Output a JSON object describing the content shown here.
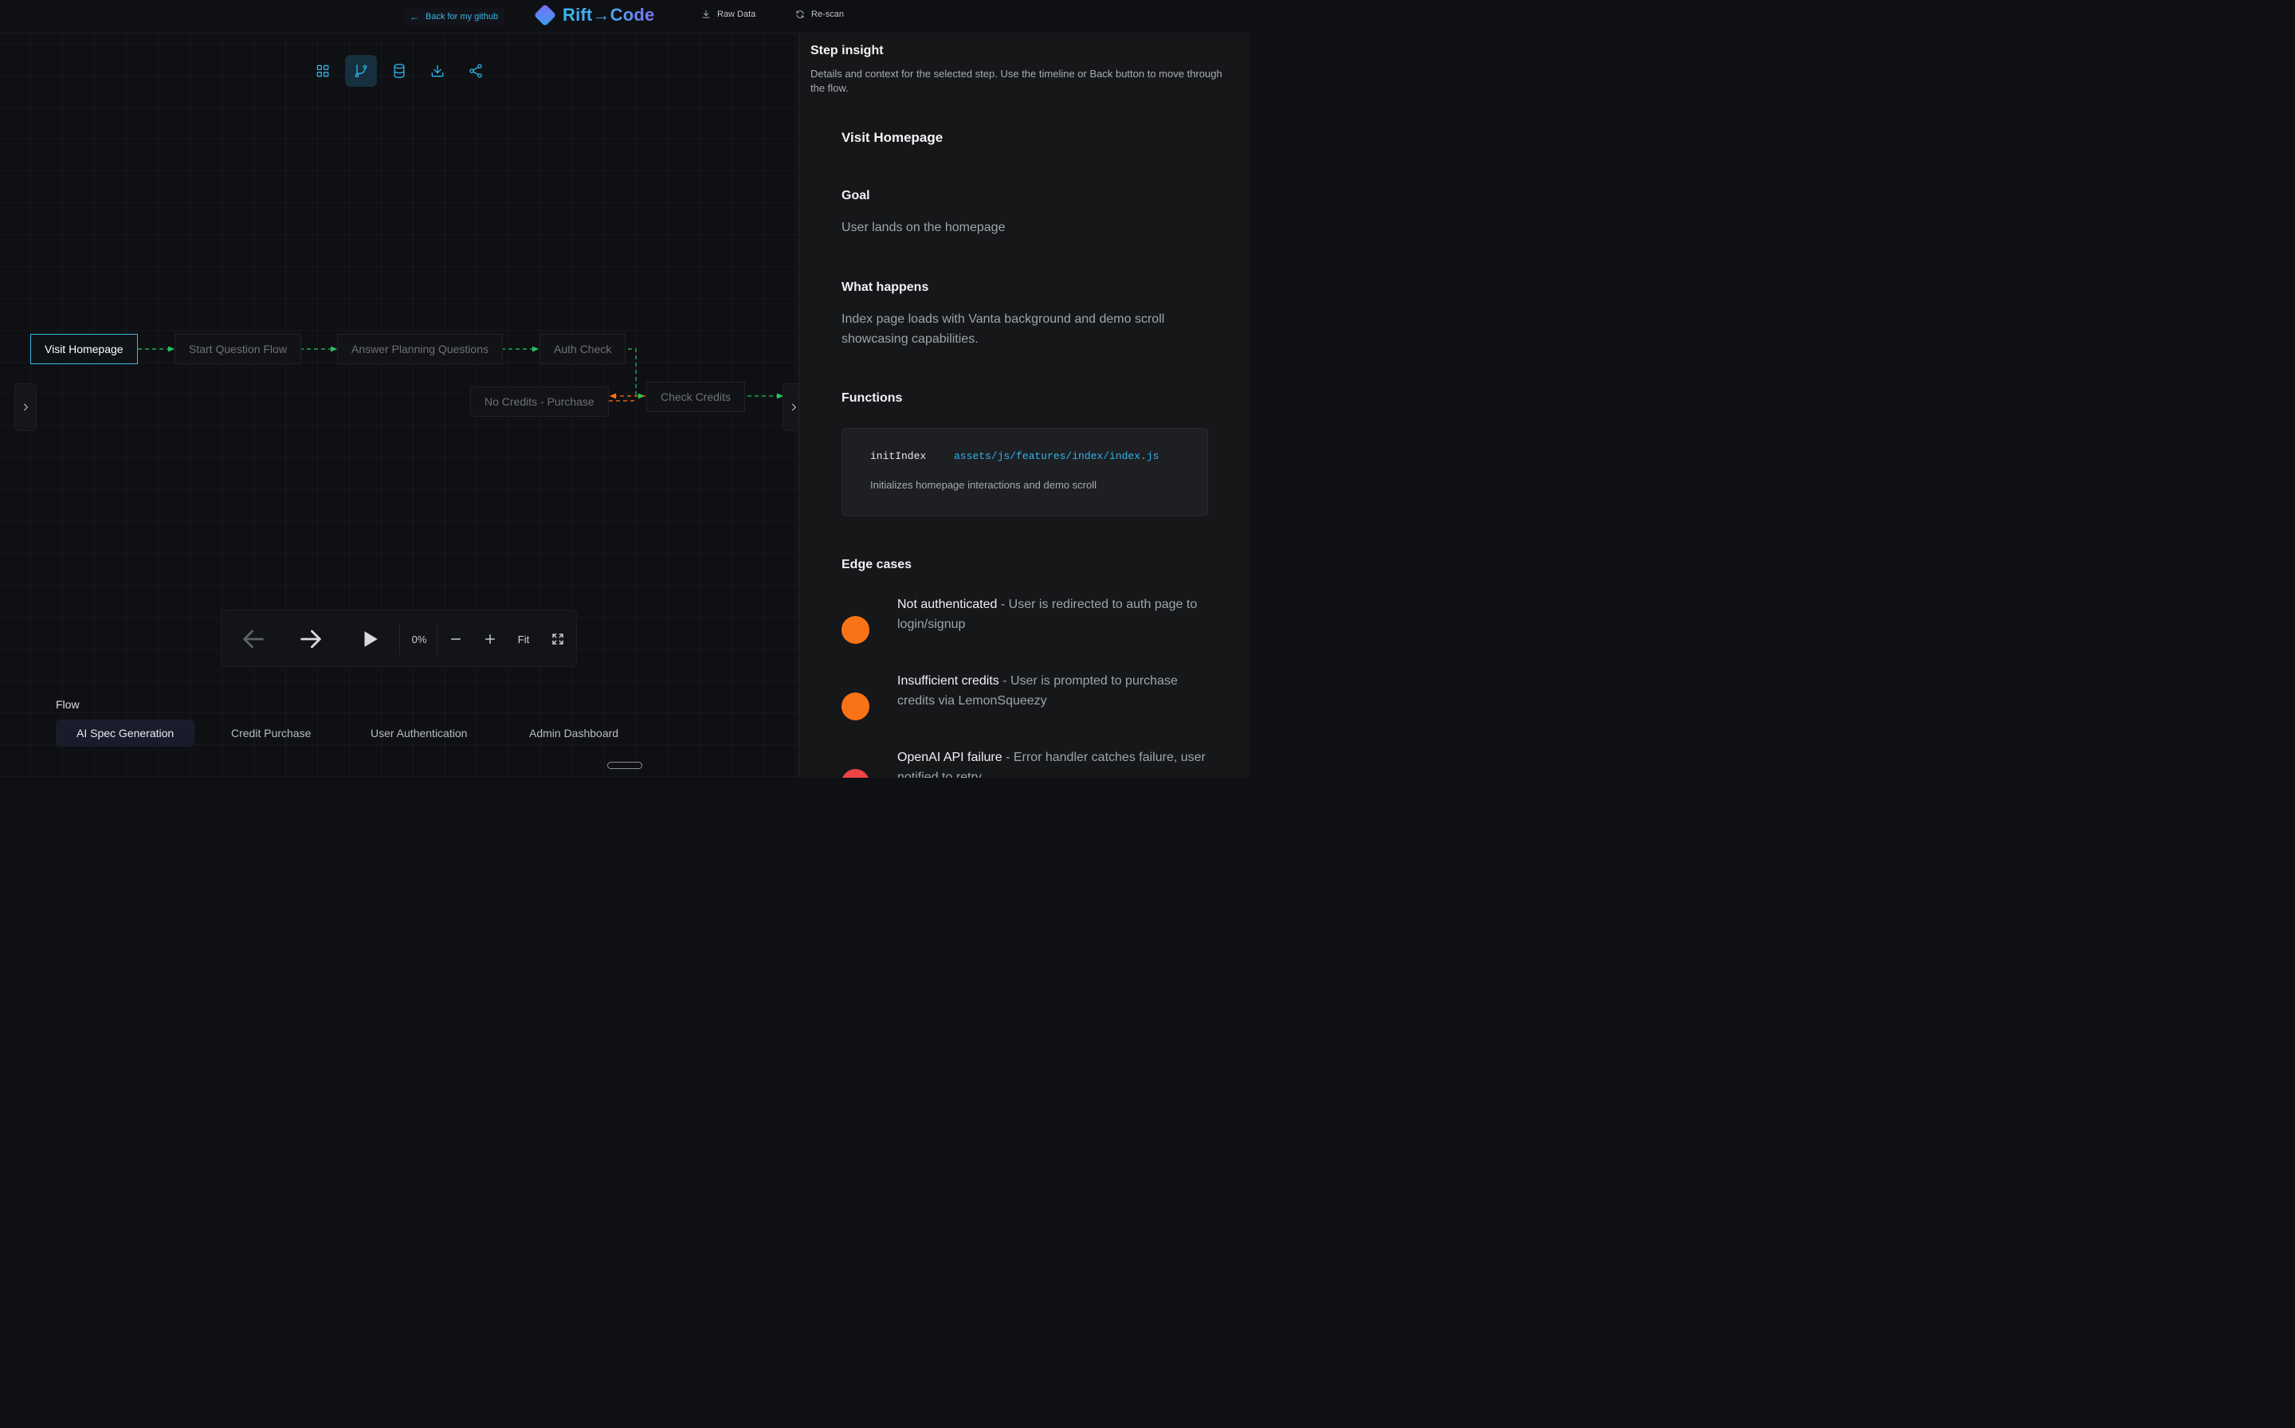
{
  "header": {
    "back_label": "Back for my github",
    "logo_text": "Rift→Code",
    "raw_data_label": "Raw Data",
    "rescan_label": "Re-scan"
  },
  "view_toolbar": {
    "buttons": [
      "grid-view",
      "flow-view",
      "database-view",
      "download",
      "share"
    ],
    "active": "flow-view"
  },
  "flow_nodes": [
    {
      "label": "Visit Homepage",
      "active": true
    },
    {
      "label": "Start Question Flow",
      "active": false
    },
    {
      "label": "Answer Planning Questions",
      "active": false
    },
    {
      "label": "Auth Check",
      "active": false
    },
    {
      "label": "No Credits - Purchase",
      "active": false
    },
    {
      "label": "Check Credits",
      "active": false
    }
  ],
  "controls": {
    "progress": "0%",
    "fit_label": "Fit"
  },
  "flows": {
    "label": "Flow",
    "tabs": [
      "AI Spec Generation",
      "Credit Purchase",
      "User Authentication",
      "Admin Dashboard"
    ],
    "active": "AI Spec Generation"
  },
  "panel": {
    "title": "Step insight",
    "description": "Details and context for the selected step. Use the timeline or Back button to move through the flow.",
    "step_name": "Visit Homepage",
    "goal_heading": "Goal",
    "goal_text": "User lands on the homepage",
    "what_heading": "What happens",
    "what_text": "Index page loads with Vanta background and demo scroll showcasing capabilities.",
    "functions_heading": "Functions",
    "functions": [
      {
        "name": "initIndex",
        "path": "assets/js/features/index/index.js",
        "description": "Initializes homepage interactions and demo scroll"
      }
    ],
    "edge_heading": "Edge cases",
    "edge_cases": [
      {
        "title": "Not authenticated",
        "text": " - User is redirected to auth page to login/signup",
        "color": "#f97316"
      },
      {
        "title": "Insufficient credits",
        "text": " - User is prompted to purchase credits via LemonSqueezy",
        "color": "#f97316"
      },
      {
        "title": "OpenAI API failure",
        "text": " - Error handler catches failure, user notified to retry",
        "color": "#ef4444"
      }
    ]
  },
  "colors": {
    "accent": "#2fb3ea",
    "edge_success": "#22c55e",
    "edge_warning": "#f97316"
  }
}
